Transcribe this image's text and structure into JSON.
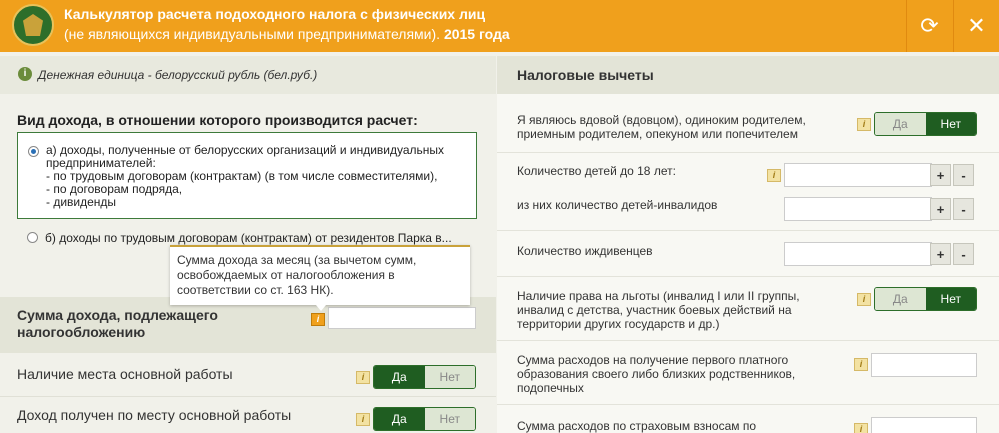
{
  "header": {
    "title_line1": "Калькулятор расчета подоходного налога с физических лиц",
    "title_line2_pre": "(не являющихся индивидуальными предпринимателями).",
    "title_line2_year": "2015 года",
    "refresh_icon": "refresh-icon",
    "close_icon": "close-icon",
    "accent_color": "#f0a01c"
  },
  "left": {
    "currency_note": "Денежная единица - белорусский рубль (бел.руб.)",
    "income_type_title": "Вид дохода, в отношении которого производится расчет:",
    "option_a": {
      "lines": [
        "а) доходы, полученные от белорусских организаций и индивидуальных",
        "предпринимателей:",
        "- по трудовым договорам (контрактам) (в том числе совместителями),",
        "- по договорам подряда,",
        "- дивиденды"
      ],
      "selected": true
    },
    "option_b": {
      "label": "б) доходы по трудовым договорам (контрактам) от резидентов Парка в...",
      "selected": false
    },
    "tooltip": "Сумма дохода за месяц (за вычетом сумм, освобождаемых от налогообложения в соответствии со ст. 163 НК).",
    "sum_label_1": "Сумма дохода, подлежащего",
    "sum_label_2": "налогообложению",
    "sum_value": "",
    "main_work_label": "Наличие места основной работы",
    "main_work_income_label": "Доход получен по месту основной работы",
    "yes": "Да",
    "no": "Нет"
  },
  "right": {
    "title": "Налоговые вычеты",
    "widow_label_1": "Я являюсь вдовой (вдовцом), одиноким родителем,",
    "widow_label_2": "приемным родителем, опекуном или попечителем",
    "children_label": "Количество детей до 18 лет:",
    "disabled_children_label": "из них количество детей-инвалидов",
    "dependents_label": "Количество иждивенцев",
    "benefits_label_1": "Наличие права на льготы (инвалид I или II группы,",
    "benefits_label_2": "инвалид с детства, участник боевых действий на",
    "benefits_label_3": "территории других государств и др.)",
    "education_label_1": "Сумма расходов на получение первого платного",
    "education_label_2": "образования своего либо близких родственников,",
    "education_label_3": "подопечных",
    "insurance_label": "Сумма расходов по страховым взносам по",
    "yes": "Да",
    "no": "Нет",
    "plus": "+",
    "minus": "-"
  }
}
